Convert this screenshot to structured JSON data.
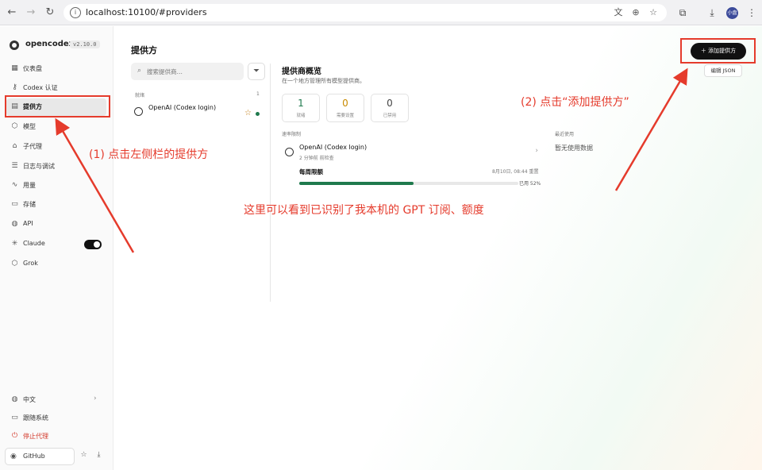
{
  "browser": {
    "url": "localhost:10100/#providers",
    "profile_label": "小盘"
  },
  "sidebar": {
    "brand": "opencodex",
    "version": "v2.10.0",
    "items": [
      {
        "label": "仪表盘",
        "icon": "dashboard-icon"
      },
      {
        "label": "Codex 认证",
        "icon": "key-icon"
      },
      {
        "label": "提供方",
        "icon": "server-icon",
        "active": true
      },
      {
        "label": "模型",
        "icon": "cube-icon"
      },
      {
        "label": "子代理",
        "icon": "robot-icon"
      },
      {
        "label": "日志与调试",
        "icon": "list-icon"
      },
      {
        "label": "用量",
        "icon": "activity-icon"
      },
      {
        "label": "存储",
        "icon": "drive-icon"
      },
      {
        "label": "API",
        "icon": "globe-icon"
      },
      {
        "label": "Claude",
        "icon": "sparkle-icon",
        "toggle_on": true
      },
      {
        "label": "Grok",
        "icon": "grok-icon"
      }
    ],
    "bottom": [
      {
        "label": "中文",
        "icon": "globe-icon"
      },
      {
        "label": "跟随系统",
        "icon": "monitor-icon"
      },
      {
        "label": "停止代理",
        "icon": "power-icon",
        "color": "#d33a2c"
      }
    ],
    "github_label": "GitHub"
  },
  "main": {
    "title": "提供方",
    "add_button": "添加提供方",
    "edit_json": "编辑 JSON",
    "search_placeholder": "搜索提供商…",
    "list_header": "就绪",
    "list_count": "1",
    "providers": [
      {
        "name": "OpenAI (Codex login)",
        "status_color": "#1f7a4d"
      }
    ],
    "overview": {
      "title": "提供商概览",
      "subtitle": "在一个地方管理所有模型提供商。",
      "stats": [
        {
          "value": "1",
          "label": "就绪",
          "color": "#1f7a4d"
        },
        {
          "value": "0",
          "label": "需要设置",
          "color": "#c88a00"
        },
        {
          "value": "0",
          "label": "已禁用",
          "color": "#444444"
        }
      ],
      "rate_limit_label": "速率限制",
      "recent_label": "最近使用",
      "rate_item": {
        "name": "OpenAI (Codex login)",
        "checked": "2 分钟前 前检查"
      },
      "weekly_label": "每周限额",
      "reset_time": "8月10日, 08:44 重置",
      "used_fraction": 0.52,
      "used_text": "已用 52%",
      "no_data": "暂无使用数据"
    }
  },
  "annotations": {
    "step1": "(1) 点击左侧栏的提供方",
    "step2": "(2) 点击“添加提供方”",
    "note": "这里可以看到已识别了我本机的 GPT 订阅、额度",
    "color": "#e53b2c"
  }
}
